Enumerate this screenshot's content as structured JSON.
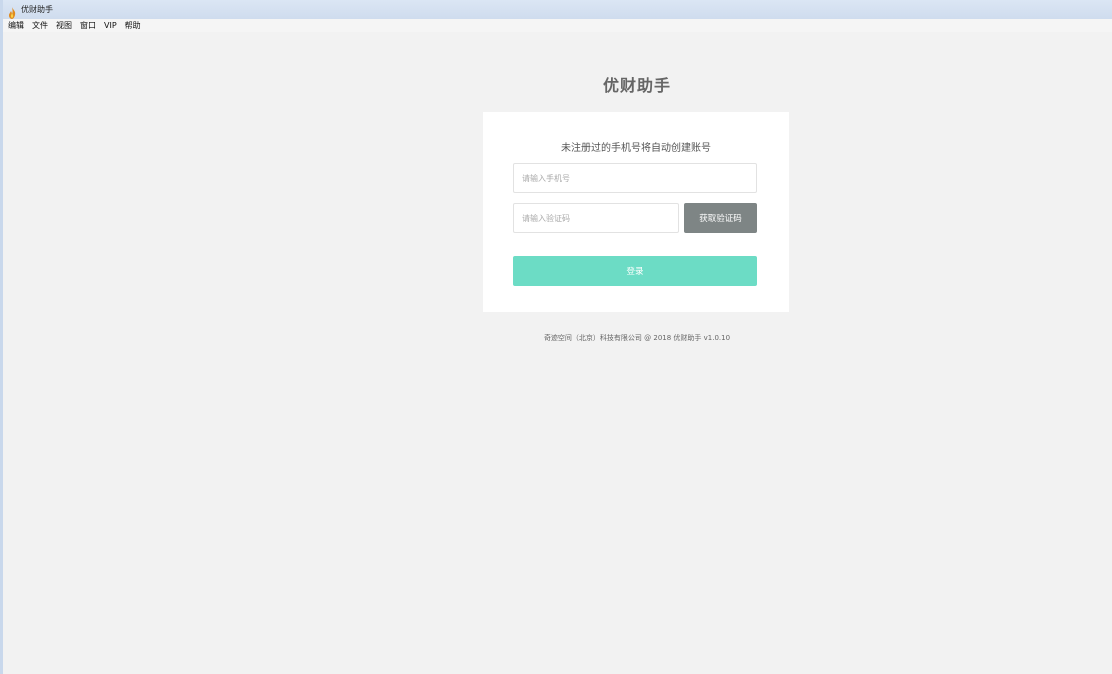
{
  "window": {
    "title": "优财助手"
  },
  "menu": {
    "items": [
      "编辑",
      "文件",
      "视图",
      "窗口",
      "VIP",
      "帮助"
    ]
  },
  "brand": {
    "title": "优财助手"
  },
  "login": {
    "hint": "未注册过的手机号将自动创建账号",
    "phone_placeholder": "请输入手机号",
    "phone_value": "",
    "code_placeholder": "请输入验证码",
    "code_value": "",
    "get_code_label": "获取验证码",
    "login_label": "登录"
  },
  "footer": {
    "text": "奇迹空间（北京）科技有限公司 @ 2018 优财助手 v1.0.10"
  },
  "colors": {
    "login_button": "#6cdcc5",
    "get_code_button": "#7e8585",
    "background": "#f2f2f2",
    "card": "#ffffff"
  },
  "icons": {
    "app": "app-flame-icon"
  }
}
